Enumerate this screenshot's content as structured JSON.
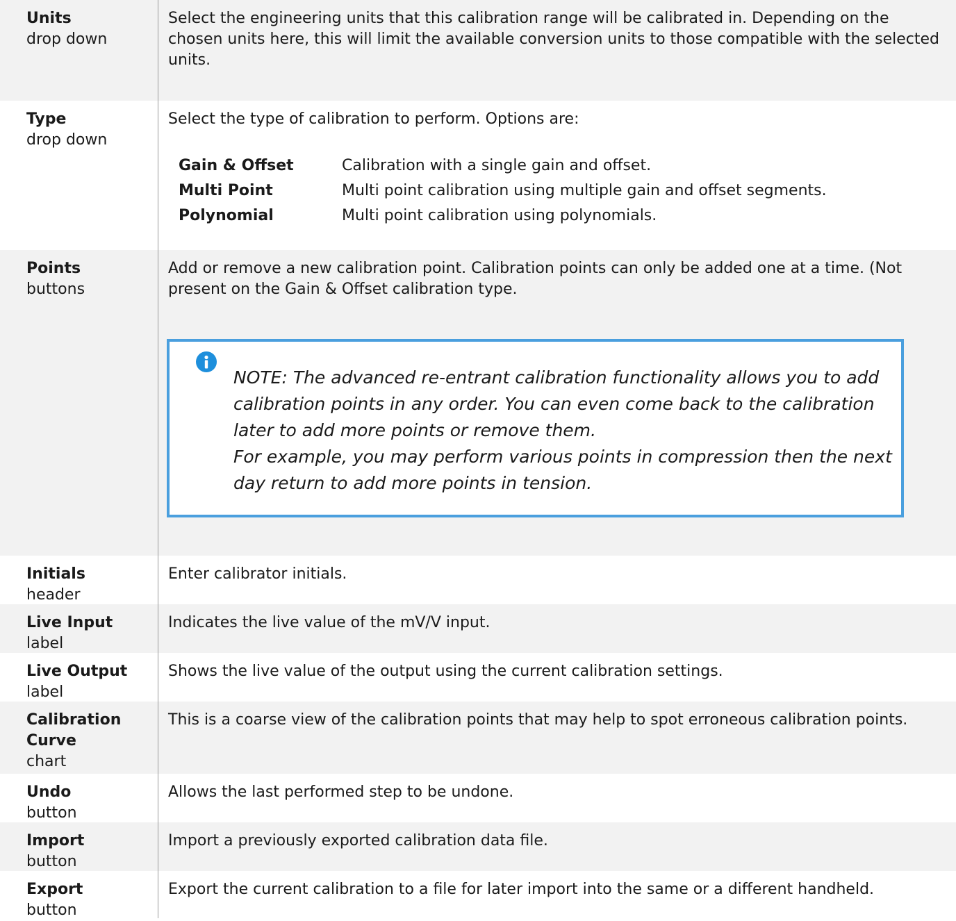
{
  "rows": [
    {
      "name": "Units",
      "kind": "drop down",
      "desc": "Select the engineering units that this calibration range will be calibrated in. Depending on the chosen units here, this will limit the available conversion units to those compatible with the selected units."
    },
    {
      "name": "Type",
      "kind": "drop down",
      "desc": "Select the type of calibration to perform. Options are:",
      "options": [
        {
          "name": "Gain & Offset",
          "desc": "Calibration with a single gain and offset."
        },
        {
          "name": "Multi Point",
          "desc": "Multi point calibration using multiple gain and offset segments."
        },
        {
          "name": "Polynomial",
          "desc": "Multi point calibration using polynomials."
        }
      ]
    },
    {
      "name": "Points",
      "kind": "buttons",
      "desc": "Add or remove a new calibration point. Calibration points can only be added one at a time. (Not present on the Gain & Offset calibration type.",
      "note": {
        "icon": "info-icon",
        "line1": "NOTE: The advanced re-entrant calibration functionality allows you to add calibration points in any order. You can even come back to the calibration later to add more points or remove them.",
        "line2": "For example, you may perform various points in compression then the next day return to add more points in tension."
      }
    },
    {
      "name": "Initials",
      "kind": "header",
      "desc": "Enter calibrator initials."
    },
    {
      "name": "Live Input",
      "kind": "label",
      "desc": "Indicates the live value of the mV/V input."
    },
    {
      "name": "Live Output",
      "kind": "label",
      "desc": "Shows the live value of the output using the current calibration settings."
    },
    {
      "name": "Calibration Curve",
      "kind": "chart",
      "desc": "This is a coarse view of the calibration points that may help to spot erroneous calibration points."
    },
    {
      "name": "Undo",
      "kind": "button",
      "desc": "Allows the last performed step to be undone."
    },
    {
      "name": "Import",
      "kind": "button",
      "desc": "Import a previously exported calibration data file."
    },
    {
      "name": "Export",
      "kind": "button",
      "desc": "Export the current calibration to a file for later import into the same or a different handheld."
    }
  ],
  "colors": {
    "row_shade": "#f2f2f2",
    "note_border": "#4a9fde",
    "info_icon": "#1e8fdc"
  }
}
